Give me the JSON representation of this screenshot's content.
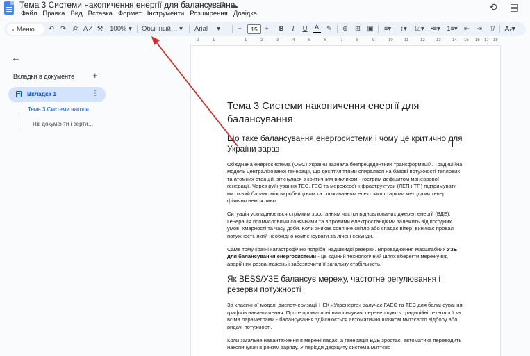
{
  "app": {
    "title": "Тема 3 Системи накопичення енергії для балансування",
    "menu": [
      "Файл",
      "Правка",
      "Вид",
      "Вставка",
      "Формат",
      "Інструменти",
      "Розширення",
      "Довідка"
    ]
  },
  "toolbar": {
    "menu_search": "Меню",
    "zoom": "100%",
    "style": "Обычный…",
    "font": "Arial",
    "font_size": "15",
    "icons": [
      "undo-icon",
      "redo-icon",
      "print-icon",
      "spellcheck-icon",
      "paint-format-icon",
      "bold-icon",
      "italic-icon",
      "underline-icon",
      "text-color-icon",
      "highlight-icon",
      "link-icon",
      "comment-icon",
      "image-icon",
      "align-icon",
      "line-spacing-icon",
      "checklist-icon",
      "bullet-list-icon",
      "numbered-list-icon",
      "indent-decrease-icon",
      "indent-increase-icon",
      "clear-format-icon",
      "spelling-mode-icon"
    ]
  },
  "ruler": {
    "ticks": [
      "2",
      "1",
      "1",
      "2",
      "3",
      "4",
      "5",
      "6",
      "7",
      "8",
      "9",
      "10",
      "11",
      "12",
      "13",
      "14",
      "15",
      "16",
      "17",
      "18"
    ]
  },
  "sidebar": {
    "heading": "Вкладки в документе",
    "add_label": "+",
    "active_tab": "Вкладка 1",
    "outline": [
      "Тема 3 Системи накопи…",
      "Які документи і серти…"
    ]
  },
  "document": {
    "title": "Тема 3 Системи накопичення енергії для балансування",
    "h2_1": "Що таке балансування енергосистеми і чому це критично для України зараз",
    "p1": "Об'єднана енергосистема (ОЕС) України зазнала безпрецедентних трансформацій. Традиційна модель централізованої генерації, що десятиліттями спиралася на базові потужності теплових та атомних станцій, зіткнулася з критичним викликом - гострим дефіцитом маневрової генерації. Через руйнування ТЕС, ГЕС та мережевої інфраструктури (ЛЕП і ТП) підтримувати миттєвий баланс між виробництвом та споживанням електрики старими методами тепер фізично неможливо.",
    "p2": "Ситуація ускладнюється стрімким зростанням частки відновлюваних джерел енергії (ВДЕ). Генерація промисловими сонячними та вітровими електростанціями залежить від погодних умов, хмарності та часу доби. Коли зникає сонячне світло або спадає вітер, виникає провал потужності, який необхідно компенсувати за лічені секунди.",
    "p3_before": "Саме тому країні катастрофічно потрібні надшвидкі резерви. Впровадження масштабних ",
    "p3_bold": "УЗЕ для балансування енергосистеми",
    "p3_after": " - це єдиний технологічний шлях вберегти мережу від аварійних розвантажень і забезпечити її загальну стабільність.",
    "h2_2": "Як BESS/УЗЕ балансує мережу, частотне регулювання і резерви потужності",
    "p4": "За класичної моделі диспетчеризації НЕК «Укренерго» залучає ГАЕС та ТЕС для балансування графіків навантаження. Проте промислові накопичувачі перевершують традиційні технології за всіма параметрами - балансування здійснюється автоматично шляхом миттєвого відбору або видачі потужності.",
    "p5": "Коли загальне навантаження в мережі падає, а генерація ВДЕ зростає, автоматика переводить накопичувач в режим заряду. У періоди дефіциту система миттєво"
  },
  "colors": {
    "accent": "#0b57d0",
    "annotation_arrow": "#d93025",
    "toolbar_bg": "#edf2fa"
  }
}
